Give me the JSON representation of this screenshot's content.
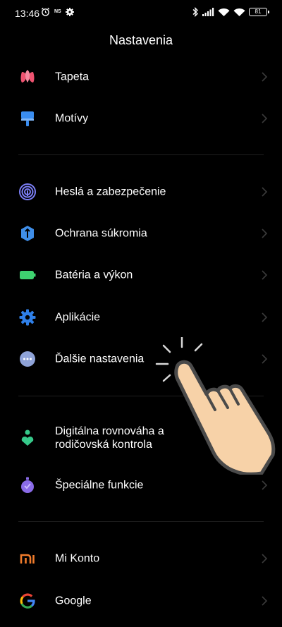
{
  "status": {
    "time": "13:46",
    "ns_label": "NS",
    "battery_level": "81"
  },
  "page": {
    "title": "Nastavenia"
  },
  "items": [
    {
      "label": "Tapeta",
      "icon": "tulip-icon",
      "color": "#ee5370"
    },
    {
      "label": "Motívy",
      "icon": "paint-brush-icon",
      "color": "#3a8df0"
    },
    {
      "label": "Heslá a zabezpečenie",
      "icon": "fingerprint-icon",
      "color": "#7b7ef5"
    },
    {
      "label": "Ochrana súkromia",
      "icon": "privacy-shield-icon",
      "color": "#3f8ee8"
    },
    {
      "label": "Batéria a výkon",
      "icon": "battery-icon",
      "color": "#3ed26f"
    },
    {
      "label": "Aplikácie",
      "icon": "gear-icon",
      "color": "#2f7fe8"
    },
    {
      "label": "Ďalšie nastavenia",
      "icon": "more-dots-icon",
      "color": "#8fa3d8"
    },
    {
      "label": "Digitálna rovnováha a rodičovská kontrola",
      "icon": "wellbeing-icon",
      "color": "#36c98a"
    },
    {
      "label": "Špeciálne funkcie",
      "icon": "special-features-icon",
      "color": "#8a6be8"
    },
    {
      "label": "Mi Konto",
      "icon": "mi-logo-icon",
      "color": "#f07b2b"
    },
    {
      "label": "Google",
      "icon": "google-icon",
      "color": "#4285f4"
    }
  ]
}
